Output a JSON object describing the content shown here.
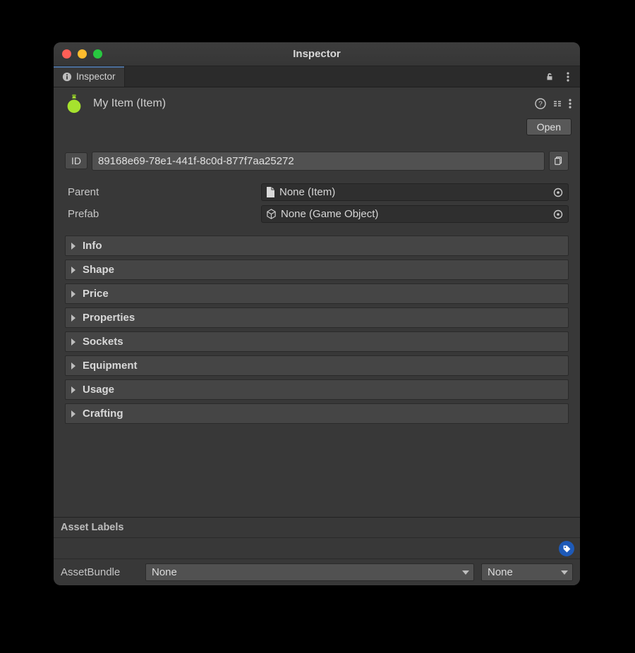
{
  "window": {
    "title": "Inspector"
  },
  "tab": {
    "label": "Inspector"
  },
  "object": {
    "title": "My Item (Item)",
    "open_button": "Open"
  },
  "id": {
    "label": "ID",
    "value": "89168e69-78e1-441f-8c0d-877f7aa25272"
  },
  "refs": {
    "parent": {
      "label": "Parent",
      "value": "None (Item)"
    },
    "prefab": {
      "label": "Prefab",
      "value": "None (Game Object)"
    }
  },
  "sections": [
    {
      "title": "Info"
    },
    {
      "title": "Shape"
    },
    {
      "title": "Price"
    },
    {
      "title": "Properties"
    },
    {
      "title": "Sockets"
    },
    {
      "title": "Equipment"
    },
    {
      "title": "Usage"
    },
    {
      "title": "Crafting"
    }
  ],
  "footer": {
    "asset_labels": "Asset Labels",
    "asset_bundle_label": "AssetBundle",
    "bundle_value": "None",
    "variant_value": "None"
  },
  "icon_names": {
    "info": "info-icon",
    "lock": "lock-open-icon",
    "menu": "kebab-menu-icon",
    "help": "help-icon",
    "presets": "presets-icon",
    "copy": "copy-icon",
    "doc": "document-icon",
    "cube": "cube-icon",
    "picker": "object-picker-icon",
    "tag": "tag-icon"
  }
}
